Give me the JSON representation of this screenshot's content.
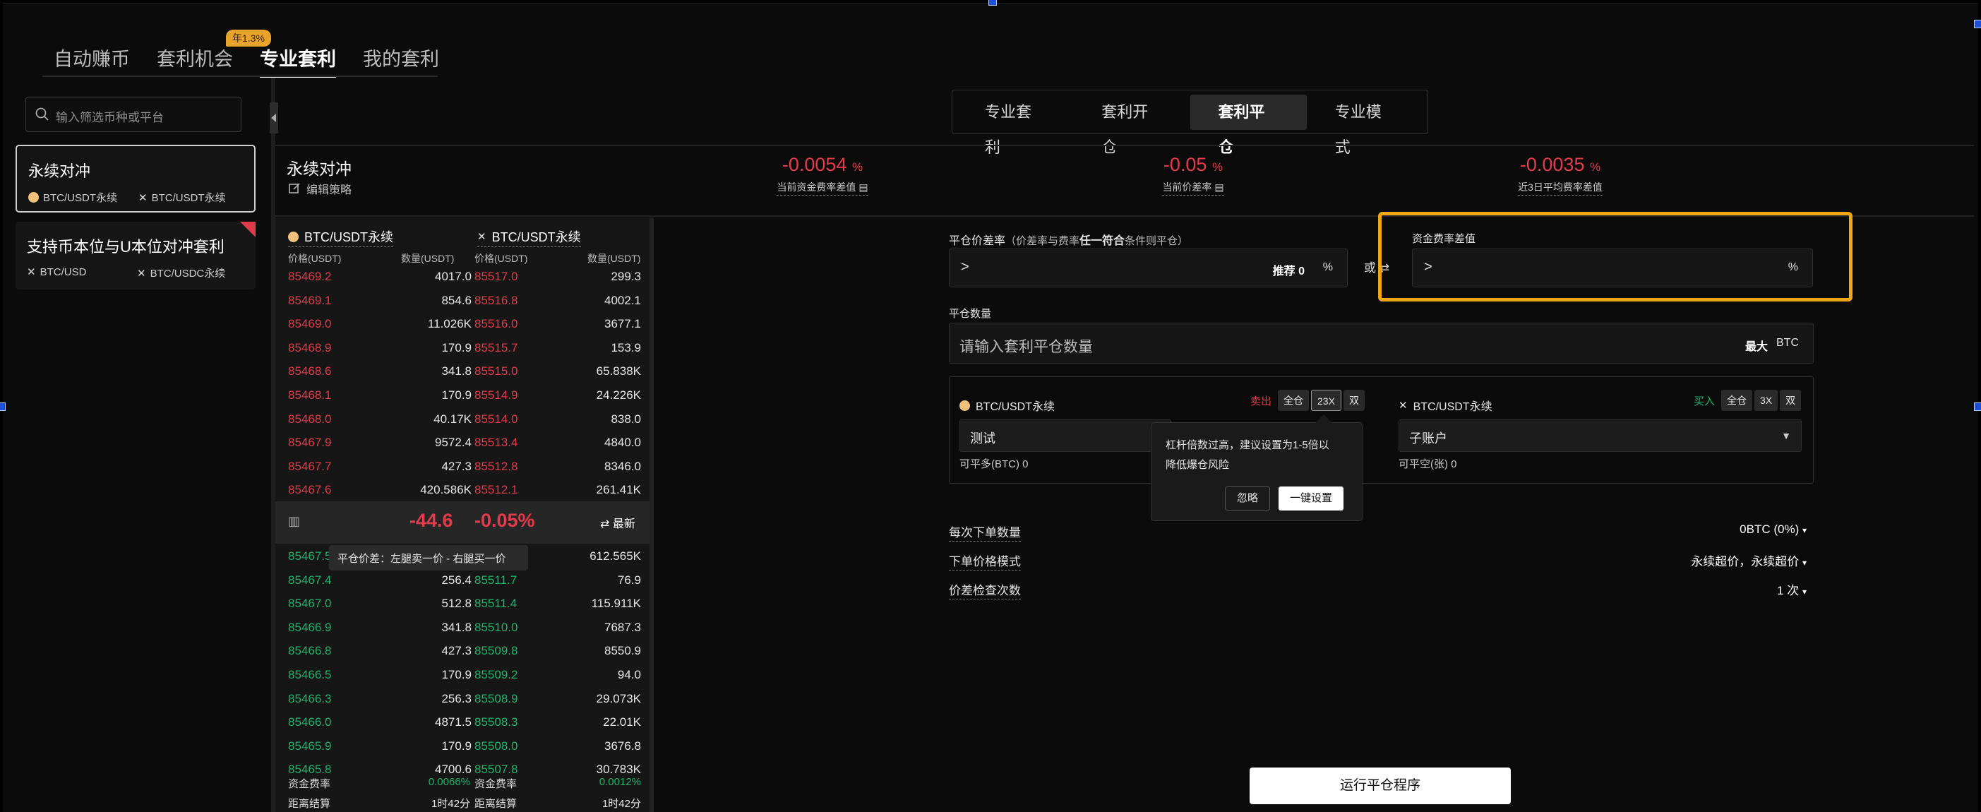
{
  "topnav": {
    "tabs": [
      {
        "label": "自动赚币",
        "active": false
      },
      {
        "label": "套利机会",
        "active": false
      },
      {
        "label": "专业套利",
        "active": true
      },
      {
        "label": "我的套利",
        "active": false
      }
    ],
    "badge": "年1.3%"
  },
  "sidebar": {
    "search_placeholder": "输入筛选币种或平台",
    "cards": [
      {
        "title": "永续对冲",
        "pair1": "BTC/USDT永续",
        "pair2": "BTC/USDT永续"
      },
      {
        "title": "支持币本位与U本位对冲套利",
        "pair1": "BTC/USD",
        "pair2": "BTC/USDC永续"
      }
    ]
  },
  "mode_tabs": [
    "专业套利",
    "套利开仓",
    "套利平仓",
    "专业模式"
  ],
  "strategy": {
    "title": "永续对冲",
    "edit_label": "编辑策略",
    "metrics": [
      {
        "value": "-0.0054",
        "unit": "%",
        "label": "当前资金费率差值"
      },
      {
        "value": "-0.05",
        "unit": "%",
        "label": "当前价差率"
      },
      {
        "value": "-0.0035",
        "unit": "%",
        "label": "近3日平均费率差值"
      }
    ]
  },
  "orderbook": {
    "left_pair": "BTC/USDT永续",
    "right_pair": "BTC/USDT永续",
    "col_price": "价格(USDT)",
    "col_qty": "数量(USDT)",
    "asks": [
      [
        "85469.2",
        "4017.0",
        "85517.0",
        "299.3"
      ],
      [
        "85469.1",
        "854.6",
        "85516.8",
        "4002.1"
      ],
      [
        "85469.0",
        "11.026K",
        "85516.0",
        "3677.1"
      ],
      [
        "85468.9",
        "170.9",
        "85515.7",
        "153.9"
      ],
      [
        "85468.6",
        "341.8",
        "85515.0",
        "65.838K"
      ],
      [
        "85468.1",
        "170.9",
        "85514.9",
        "24.226K"
      ],
      [
        "85468.0",
        "40.17K",
        "85514.0",
        "838.0"
      ],
      [
        "85467.9",
        "9572.4",
        "85513.4",
        "4840.0"
      ],
      [
        "85467.7",
        "427.3",
        "85512.8",
        "8346.0"
      ],
      [
        "85467.6",
        "420.586K",
        "85512.1",
        "261.41K"
      ]
    ],
    "spread_value": "-44.6",
    "spread_pct": "-0.05%",
    "latest_label": "最新",
    "tooltip": "平仓价差：左腿卖一价 - 右腿买一价",
    "bids": [
      [
        "85467.5",
        "",
        "",
        "612.565K"
      ],
      [
        "85467.4",
        "256.4",
        "85511.7",
        "76.9"
      ],
      [
        "85467.0",
        "512.8",
        "85511.4",
        "115.911K"
      ],
      [
        "85466.9",
        "341.8",
        "85510.0",
        "7687.3"
      ],
      [
        "85466.8",
        "427.3",
        "85509.8",
        "8550.9"
      ],
      [
        "85466.5",
        "170.9",
        "85509.2",
        "94.0"
      ],
      [
        "85466.3",
        "256.3",
        "85508.9",
        "29.073K"
      ],
      [
        "85466.0",
        "4871.5",
        "85508.3",
        "22.01K"
      ],
      [
        "85465.9",
        "170.9",
        "85508.0",
        "3676.8"
      ],
      [
        "85465.8",
        "4700.6",
        "85507.8",
        "30.783K"
      ]
    ],
    "footer": [
      {
        "label": "资金费率",
        "left": "0.0066%",
        "label2": "资金费率",
        "right": "0.0012%"
      },
      {
        "label": "距离结算",
        "left": "1时42分",
        "label2": "距离结算",
        "right": "1时42分"
      }
    ]
  },
  "form": {
    "spread_label": "平仓价差率",
    "spread_hint_pre": "（价差率与费率",
    "spread_hint_bold": "任一符合",
    "spread_hint_post": "条件则平仓）",
    "spread_value": ">",
    "recommend_label": "推荐",
    "recommend_value": "0",
    "percent": "%",
    "or_label": "或",
    "funding_label": "资金费率差值",
    "funding_value": ">",
    "qty_label": "平仓数量",
    "qty_placeholder": "请输入套利平仓数量",
    "max_label": "最大",
    "qty_unit": "BTC",
    "leg_left": {
      "pair": "BTC/USDT永续",
      "side": "卖出",
      "margin": "全仓",
      "leverage": "23X",
      "mode": "双",
      "account": "测试",
      "avail": "可平多(BTC) 0"
    },
    "leg_right": {
      "pair": "BTC/USDT永续",
      "side": "买入",
      "margin": "全仓",
      "leverage": "3X",
      "mode": "双",
      "account": "子账户",
      "avail": "可平空(张) 0"
    },
    "popover": {
      "line1": "杠杆倍数过高，建议设置为1-5倍以",
      "line2": "降低爆仓风险",
      "ignore": "忽略",
      "one_click": "一键设置"
    },
    "settings": [
      {
        "label": "每次下单数量",
        "value": "0BTC (0%)"
      },
      {
        "label": "下单价格模式",
        "value": "永续超价，永续超价"
      },
      {
        "label": "价差检查次数",
        "value": "1 次"
      }
    ],
    "run_button": "运行平仓程序"
  },
  "colors": {
    "accent_red": "#e23b4b",
    "accent_green": "#1fb36b",
    "highlight": "#f0a713"
  }
}
